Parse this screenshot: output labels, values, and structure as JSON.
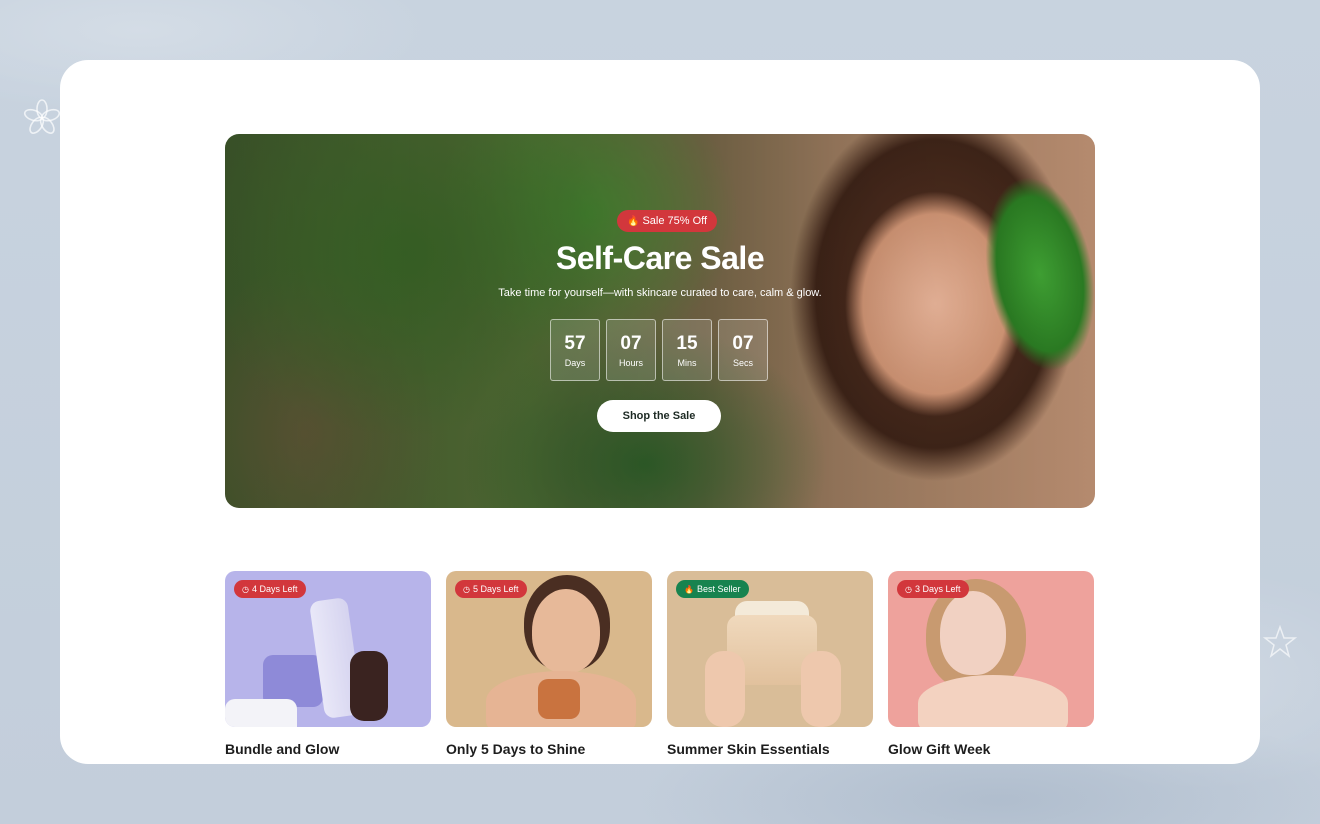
{
  "hero": {
    "badge_icon": "flame-icon",
    "badge_label": "Sale 75% Off",
    "title": "Self-Care Sale",
    "subtitle": "Take time for yourself—with skincare curated to care, calm & glow.",
    "countdown": [
      {
        "value": "57",
        "label": "Days"
      },
      {
        "value": "07",
        "label": "Hours"
      },
      {
        "value": "15",
        "label": "Mins"
      },
      {
        "value": "07",
        "label": "Secs"
      }
    ],
    "cta_label": "Shop the Sale"
  },
  "cards": [
    {
      "badge": "4 Days Left",
      "badge_icon": "clock-icon",
      "badge_color": "#d2373c",
      "title": "Bundle and Glow",
      "bg": "#b7b4ea"
    },
    {
      "badge": "5 Days Left",
      "badge_icon": "clock-icon",
      "badge_color": "#d2373c",
      "title": "Only 5 Days to Shine",
      "bg": "#d9b88c"
    },
    {
      "badge": "Best Seller",
      "badge_icon": "flame-icon",
      "badge_color": "#17834f",
      "title": "Summer Skin Essentials",
      "bg": "#d9bd98"
    },
    {
      "badge": "3 Days Left",
      "badge_icon": "clock-icon",
      "badge_color": "#d2373c",
      "title": "Glow Gift Week",
      "bg": "#eea29c"
    }
  ],
  "colors": {
    "accent_red": "#d2373c",
    "accent_green": "#17834f",
    "panel_bg": "#ffffff",
    "page_bg": "#c6d1de"
  }
}
